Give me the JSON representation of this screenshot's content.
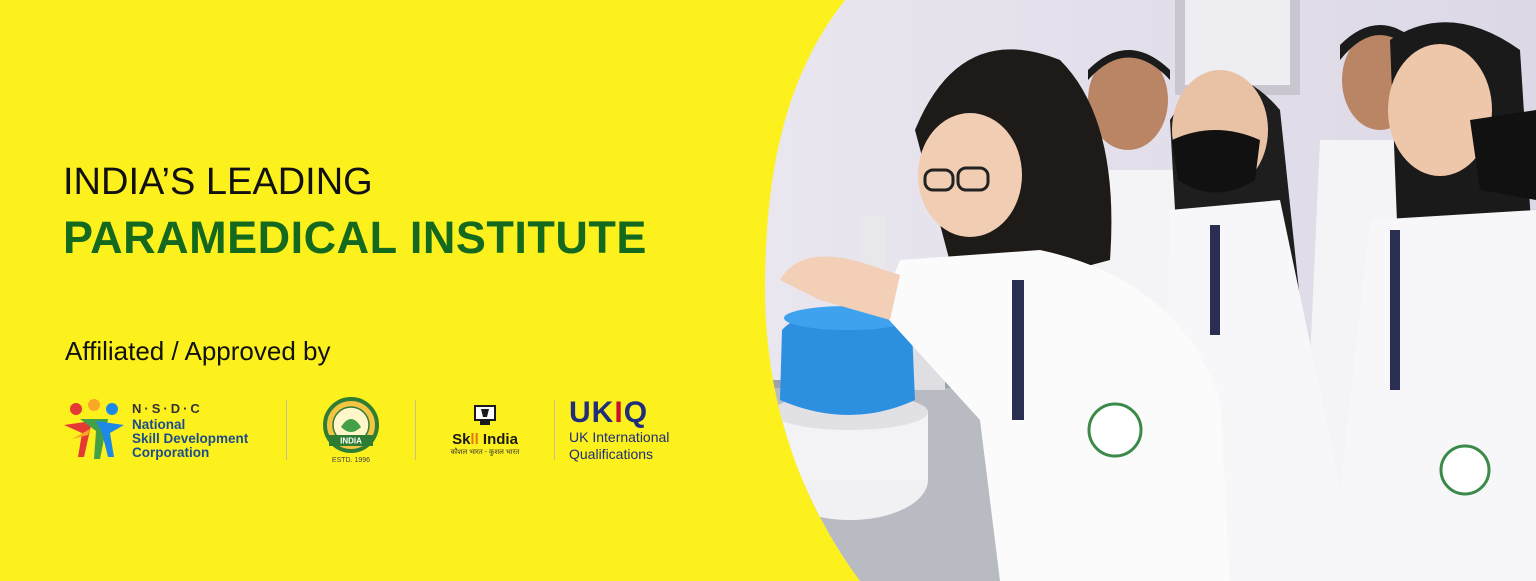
{
  "headline": {
    "line1": "INDIA’S LEADING",
    "line2": "PARAMEDICAL INSTITUTE"
  },
  "affiliated_label": "Affiliated / Approved by",
  "logos": {
    "nsdc": {
      "abbr": "N·S·D·C",
      "name_line1": "National",
      "name_line2": "Skill Development",
      "name_line3": "Corporation"
    },
    "seal": {
      "country": "INDIA",
      "est": "ESTD. 1996"
    },
    "skill_india": {
      "title_pre": "Sk",
      "title_mid": "ll",
      "title_post": " India",
      "subtitle": "कौशल भारत - कुशल भारत"
    },
    "ukiq": {
      "mark_u": "U",
      "mark_k": "K",
      "mark_i": "I",
      "mark_q": "Q",
      "line1": "UK International",
      "line2": "Qualifications"
    }
  },
  "colors": {
    "background": "#fdf11d",
    "headline_green": "#15691f",
    "nsdc_blue": "#1b4d8c",
    "ukiq_navy": "#1f2d7a",
    "ukiq_red": "#c8102e"
  }
}
